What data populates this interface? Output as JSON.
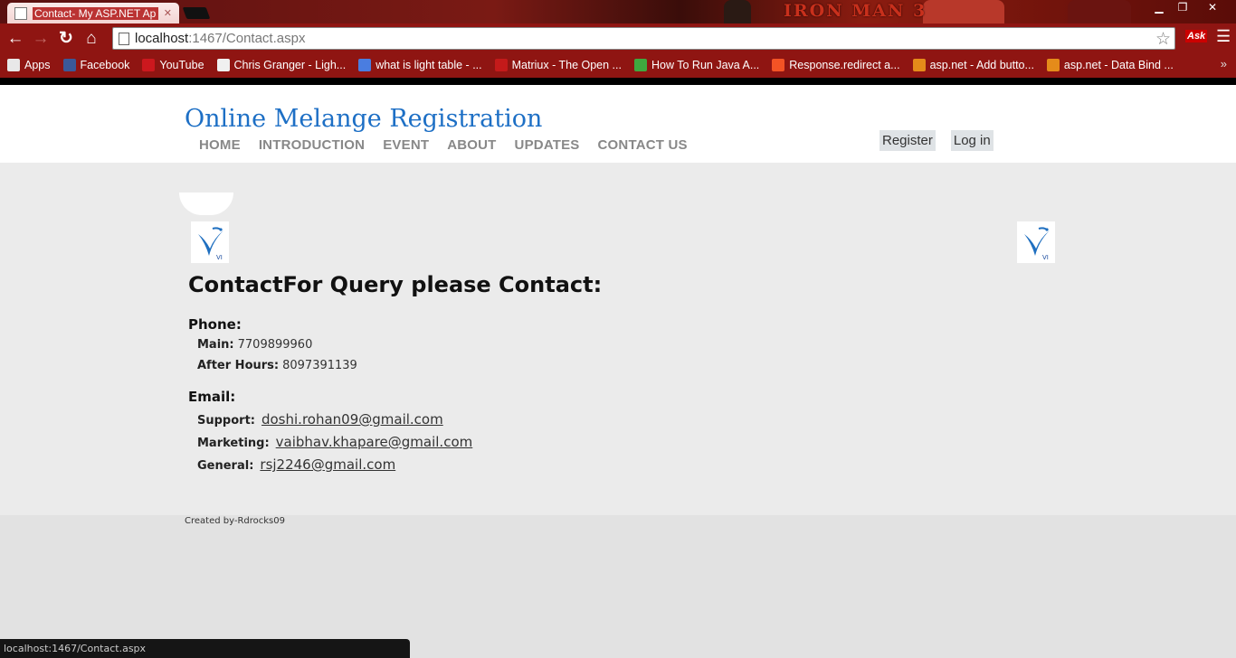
{
  "browser": {
    "tab_title": "Contact- My ASP.NET Ap",
    "banner_text": "IRON MAN 3",
    "url_host": "localhost",
    "url_rest": ":1467/Contact.aspx",
    "bookmarks": [
      {
        "label": "Apps",
        "color": "#e8e8e8"
      },
      {
        "label": "Facebook",
        "color": "#3b5998"
      },
      {
        "label": "YouTube",
        "color": "#cc181e"
      },
      {
        "label": "Chris Granger - Ligh...",
        "color": "#f0f0f0"
      },
      {
        "label": "what is light table - ...",
        "color": "#4a7de0"
      },
      {
        "label": "Matriux - The Open ...",
        "color": "#c41a1a"
      },
      {
        "label": "How To Run Java A...",
        "color": "#3fa83f"
      },
      {
        "label": "Response.redirect a...",
        "color": "#f35325"
      },
      {
        "label": "asp.net - Add butto...",
        "color": "#e58b1a"
      },
      {
        "label": "asp.net - Data Bind ...",
        "color": "#e58b1a"
      }
    ],
    "status_text": "localhost:1467/Contact.aspx"
  },
  "site": {
    "title": "Online Melange Registration",
    "nav": [
      "HOME",
      "INTRODUCTION",
      "EVENT",
      "ABOUT",
      "UPDATES",
      "CONTACT US"
    ],
    "register": "Register",
    "login": "Log in"
  },
  "contact": {
    "heading": "ContactFor Query please Contact:",
    "phone_title": "Phone:",
    "main_label": "Main:",
    "main_value": "7709899960",
    "after_label": "After Hours:",
    "after_value": "8097391139",
    "email_title": "Email:",
    "support_label": "Support:",
    "support_email": "doshi.rohan09@gmail.com",
    "marketing_label": "Marketing:",
    "marketing_email": "vaibhav.khapare@gmail.com",
    "general_label": "General:",
    "general_email": "rsj2246@gmail.com"
  },
  "footer": "Created by-Rdrocks09"
}
